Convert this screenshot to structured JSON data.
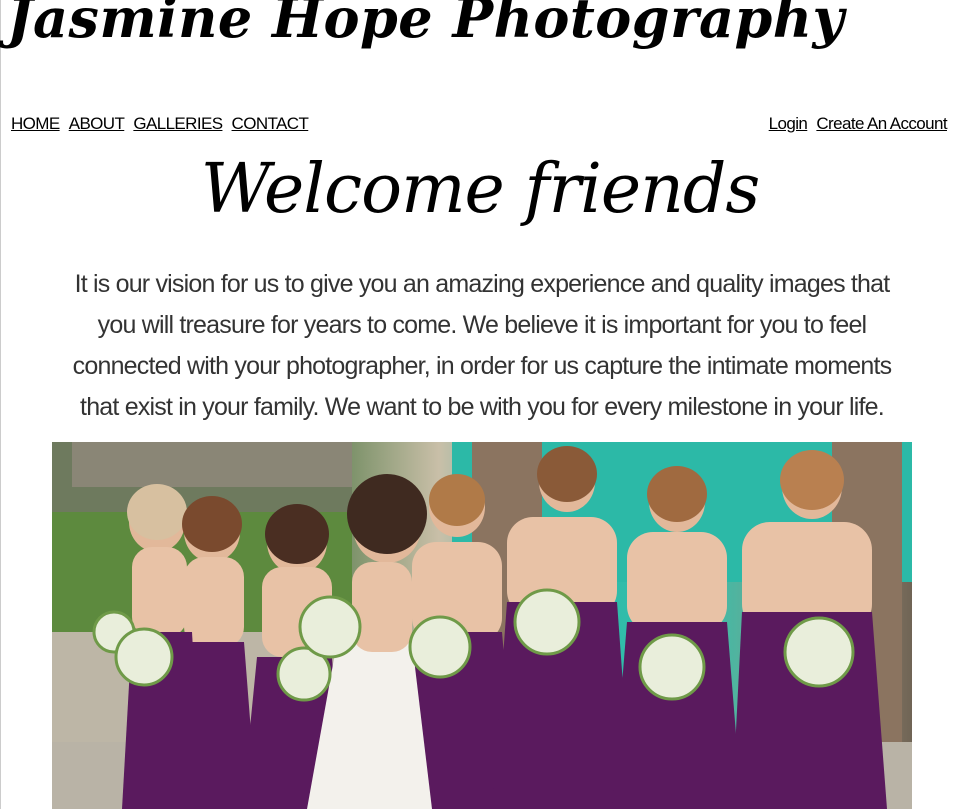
{
  "header": {
    "site_title": "Jasmine Hope Photography"
  },
  "nav": {
    "left": [
      {
        "label": "HOME"
      },
      {
        "label": "ABOUT"
      },
      {
        "label": "GALLERIES"
      },
      {
        "label": "CONTACT"
      }
    ],
    "right": [
      {
        "label": "Login"
      },
      {
        "label": "Create An Account"
      }
    ]
  },
  "main": {
    "heading": "Welcome friends",
    "intro": "It is our vision for us to give you an amazing experience and quality images that you will treasure for years to come. We believe it is important for you to feel connected with your photographer, in order for us capture the intimate moments that exist in your family. We want to be with you for every milestone in your life."
  },
  "colors": {
    "dress": "#5a1a5e",
    "bride_dress": "#f3f1ec",
    "background_teal": "#2fb8a6"
  }
}
